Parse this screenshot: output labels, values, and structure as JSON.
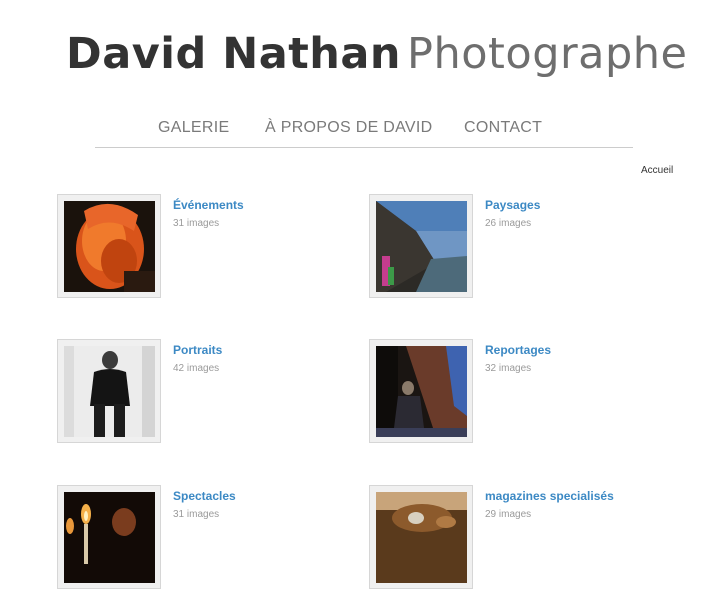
{
  "site": {
    "title_name": "David  Nathan",
    "title_suffix": "Photographe"
  },
  "nav": {
    "items": [
      "GALERIE",
      "À PROPOS DE DAVID",
      "CONTACT"
    ]
  },
  "breadcrumb": "Accueil",
  "galleries": [
    {
      "title": "Événements",
      "count": "31 images"
    },
    {
      "title": "Paysages",
      "count": "26 images"
    },
    {
      "title": "Portraits",
      "count": "42 images"
    },
    {
      "title": "Reportages",
      "count": "32 images"
    },
    {
      "title": "Spectacles",
      "count": "31 images"
    },
    {
      "title": "magazines specialisés",
      "count": "29 images"
    }
  ]
}
